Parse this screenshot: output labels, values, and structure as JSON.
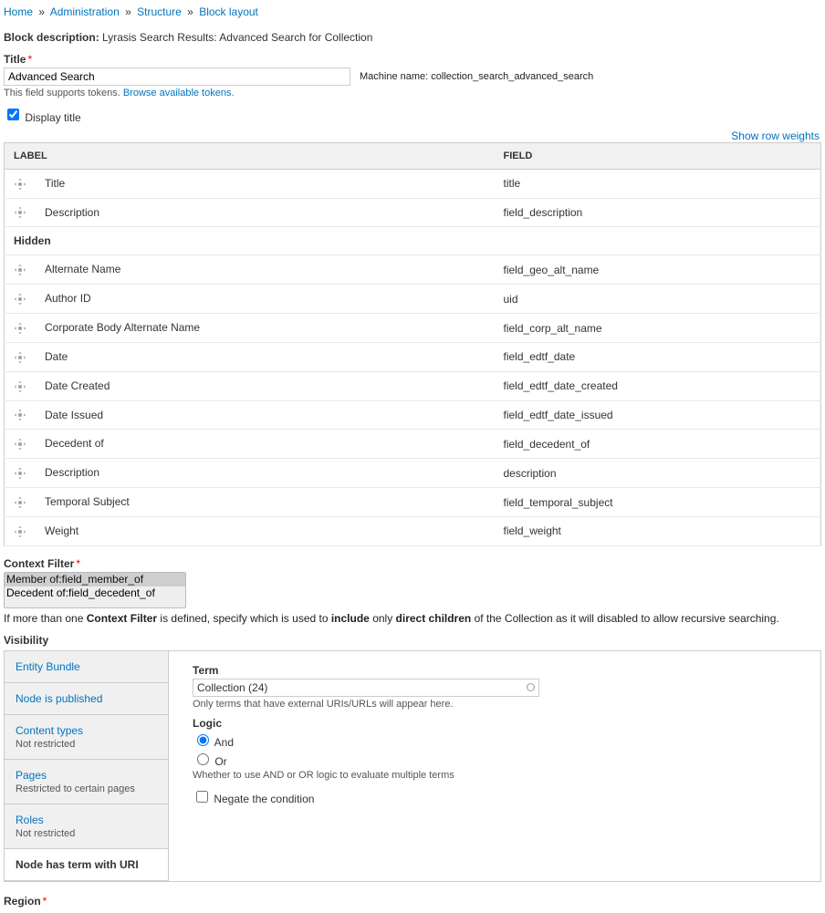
{
  "breadcrumb": {
    "home": "Home",
    "admin": "Administration",
    "structure": "Structure",
    "block_layout": "Block layout",
    "sep": "»"
  },
  "block_description_label": "Block description:",
  "block_description_value": "Lyrasis Search Results: Advanced Search for Collection",
  "title_label": "Title",
  "title_value": "Advanced Search",
  "machine_name_label": "Machine name:",
  "machine_name_value": "collection_search_advanced_search",
  "tokens_help_prefix": "This field supports tokens. ",
  "tokens_help_link": "Browse available tokens.",
  "display_title_label": "Display title",
  "show_row_weights": "Show row weights",
  "th_label": "LABEL",
  "th_field": "FIELD",
  "section_hidden": "Hidden",
  "rows_visible": [
    {
      "label": "Title",
      "field": "title"
    },
    {
      "label": "Description",
      "field": "field_description"
    }
  ],
  "rows_hidden": [
    {
      "label": "Alternate Name",
      "field": "field_geo_alt_name"
    },
    {
      "label": "Author ID",
      "field": "uid"
    },
    {
      "label": "Corporate Body Alternate Name",
      "field": "field_corp_alt_name"
    },
    {
      "label": "Date",
      "field": "field_edtf_date"
    },
    {
      "label": "Date Created",
      "field": "field_edtf_date_created"
    },
    {
      "label": "Date Issued",
      "field": "field_edtf_date_issued"
    },
    {
      "label": "Decedent of",
      "field": "field_decedent_of"
    },
    {
      "label": "Description",
      "field": "description"
    },
    {
      "label": "Temporal Subject",
      "field": "field_temporal_subject"
    },
    {
      "label": "Weight",
      "field": "field_weight"
    }
  ],
  "context_filter_label": "Context Filter",
  "context_options": [
    "Member of:field_member_of",
    "Decedent of:field_decedent_of"
  ],
  "context_help_a": "If more than one ",
  "context_help_b": "Context Filter",
  "context_help_c": " is defined, specify which is used to ",
  "context_help_d": "include",
  "context_help_e": " only ",
  "context_help_f": "direct children",
  "context_help_g": " of the Collection as it will disabled to allow recursive searching.",
  "visibility_label": "Visibility",
  "tabs": [
    {
      "title": "Entity Bundle",
      "sub": ""
    },
    {
      "title": "Node is published",
      "sub": ""
    },
    {
      "title": "Content types",
      "sub": "Not restricted"
    },
    {
      "title": "Pages",
      "sub": "Restricted to certain pages"
    },
    {
      "title": "Roles",
      "sub": "Not restricted"
    },
    {
      "title": "Node has term with URI",
      "sub": ""
    }
  ],
  "term_label": "Term",
  "term_value": "Collection (24)",
  "term_help": "Only terms that have external URIs/URLs will appear here.",
  "logic_label": "Logic",
  "logic_and": "And",
  "logic_or": "Or",
  "logic_help": "Whether to use AND or OR logic to evaluate multiple terms",
  "negate_label": "Negate the condition",
  "region_label": "Region"
}
